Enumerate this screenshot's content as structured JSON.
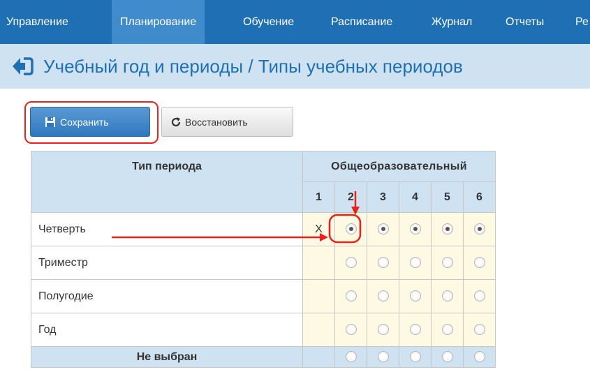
{
  "nav": {
    "items": [
      {
        "label": "Управление"
      },
      {
        "label": "Планирование"
      },
      {
        "label": "Обучение"
      },
      {
        "label": "Расписание"
      },
      {
        "label": "Журнал"
      },
      {
        "label": "Отчеты"
      },
      {
        "label": "Ре"
      }
    ],
    "active": "Планирование"
  },
  "header": {
    "title": "Учебный год и периоды / Типы учебных периодов",
    "back_icon": "back-arrow-icon"
  },
  "toolbar": {
    "save_label": "Сохранить",
    "save_icon": "save-icon",
    "restore_label": "Восстановить",
    "restore_icon": "refresh-icon"
  },
  "table": {
    "col_header": "Тип периода",
    "group_header": "Общеобразовательный",
    "columns": [
      "1",
      "2",
      "3",
      "4",
      "5",
      "6"
    ],
    "rows": [
      {
        "label": "Четверть",
        "col1": "X",
        "selected": true
      },
      {
        "label": "Триместр",
        "col1": "",
        "selected": false
      },
      {
        "label": "Полугодие",
        "col1": "",
        "selected": false
      },
      {
        "label": "Год",
        "col1": "",
        "selected": false
      },
      {
        "label": "Не выбран",
        "col1": "",
        "selected": false
      }
    ]
  },
  "colors": {
    "nav_bg": "#1e6fb3",
    "nav_active": "#3f8bcb",
    "title_bg": "#cfe2f1",
    "title_text": "#1e6fb3",
    "cell_bg": "#fdf9e3",
    "annotation": "#e8211b"
  }
}
